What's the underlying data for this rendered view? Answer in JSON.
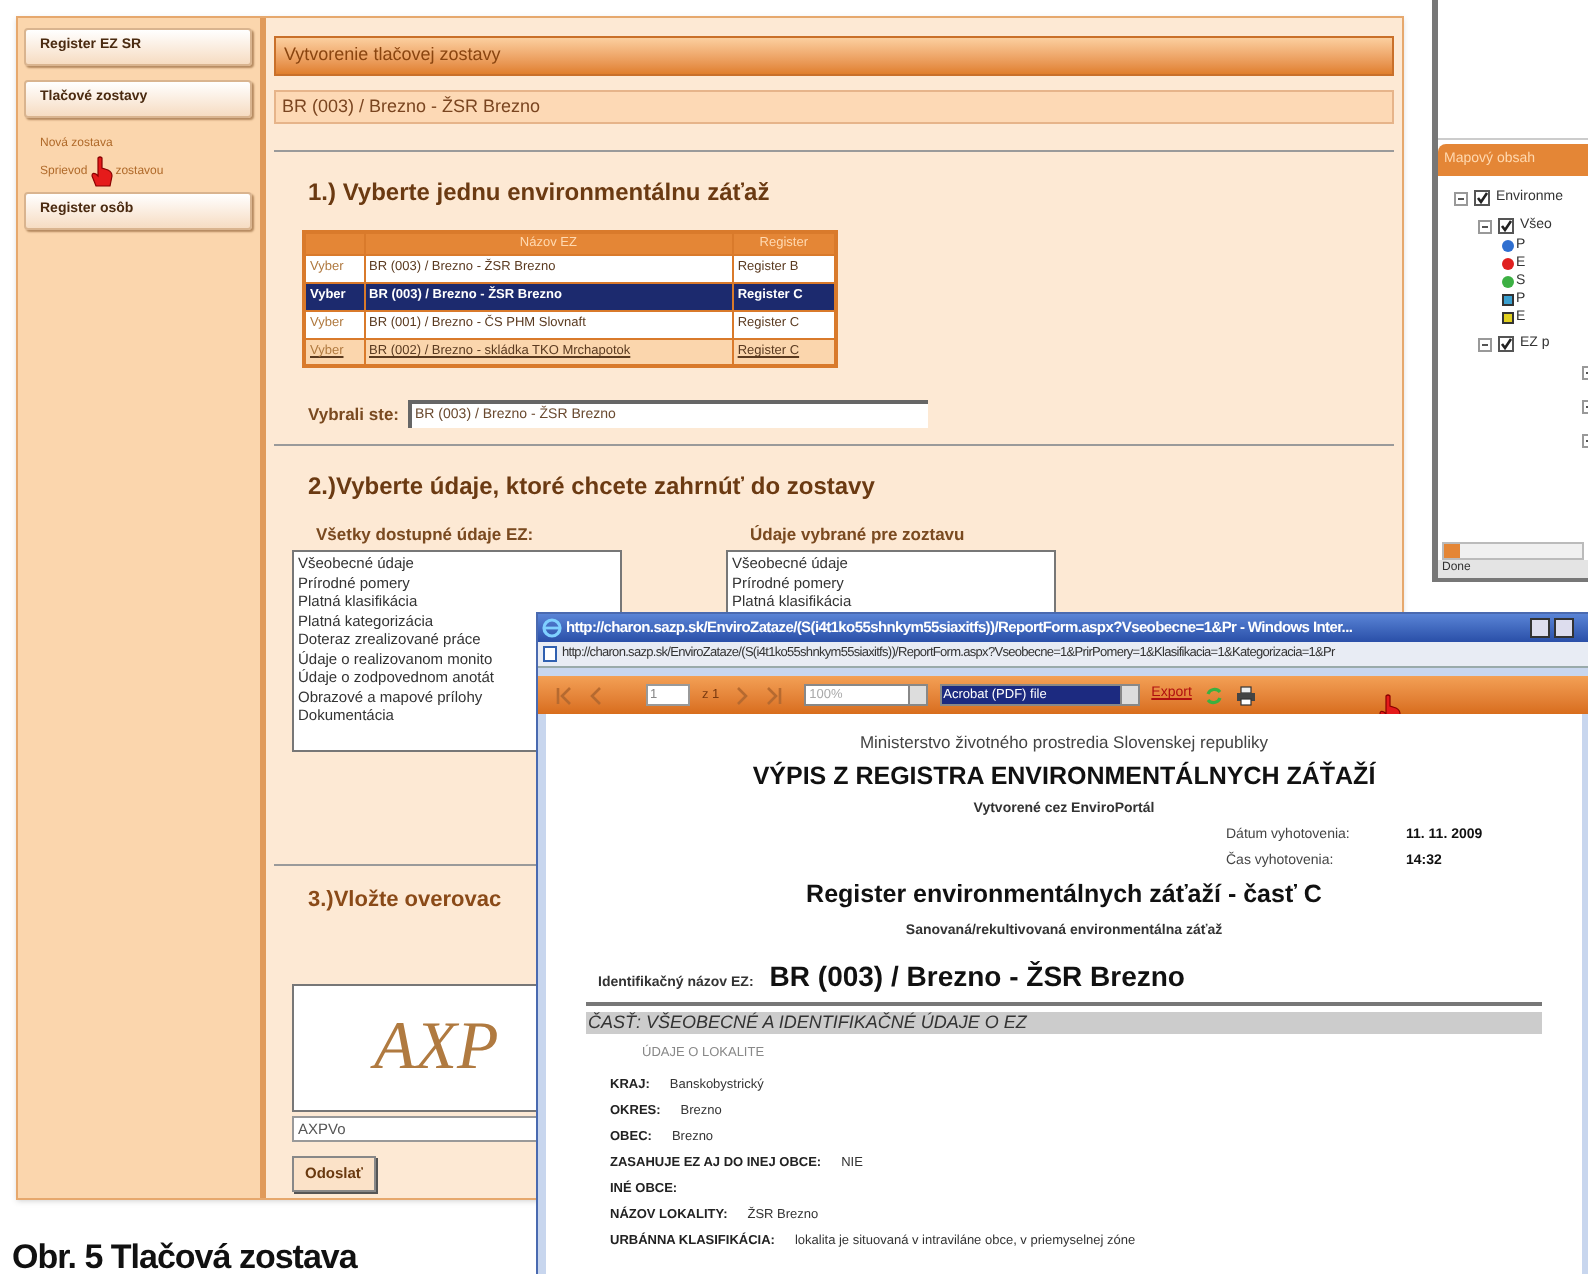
{
  "sidebar": {
    "items": [
      {
        "kind": "button",
        "label": "Register EZ SR"
      },
      {
        "kind": "button",
        "label": "Tlačové zostavy"
      },
      {
        "kind": "link",
        "label": "Nová zostava"
      },
      {
        "kind": "covered_link",
        "parts": [
          "Sprievod",
          "zostavou"
        ]
      },
      {
        "kind": "button",
        "label": "Register osôb"
      }
    ]
  },
  "page_header": "Vytvorenie tlačovej zostavy",
  "selected_bar": "BR (003) / Brezno - ŽSR Brezno",
  "step1": {
    "heading": "1.) Vyberte jednu environmentálnu záťaž",
    "table": {
      "columns": [
        "Názov EZ",
        "Register"
      ],
      "rows": [
        {
          "action": "Vyber",
          "name": "BR (003) / Brezno - ŽSR Brezno",
          "register": "Register B",
          "selected": false,
          "hovered": false
        },
        {
          "action": "Vyber",
          "name": "BR (003) / Brezno - ŽSR Brezno",
          "register": "Register C",
          "selected": true,
          "hovered": false
        },
        {
          "action": "Vyber",
          "name": "BR (001) / Brezno - ČS PHM Slovnaft",
          "register": "Register C",
          "selected": false,
          "hovered": false
        },
        {
          "action": "Vyber",
          "name": "BR (002) / Brezno - skládka TKO Mrchapotok",
          "register": "Register C",
          "selected": false,
          "hovered": true
        }
      ]
    },
    "chosen_label": "Vybrali ste:",
    "chosen_value": "BR (003) / Brezno - ŽSR Brezno"
  },
  "step2": {
    "heading": "2.)Vyberte údaje, ktoré chcete zahrnúť do zostavy",
    "available_label": "Všetky dostupné údaje EZ:",
    "available_items": [
      "Všeobecné údaje",
      "Prírodné pomery",
      "Platná klasifikácia",
      "Platná kategorizácia",
      "Doteraz zrealizované práce",
      "Údaje o realizovanom monito",
      "Údaje o zodpovednom anotát",
      "Obrazové a mapové prílohy",
      "Dokumentácia"
    ],
    "chosen_label": "Údaje vybrané pre zoztavu",
    "chosen_items": [
      "Všeobecné údaje",
      "Prírodné pomery",
      "Platná klasifikácia"
    ]
  },
  "step3": {
    "heading": "3.)Vložte overovac",
    "captcha": "AXP",
    "input_value": "AXPVo",
    "button": "Odoslať"
  },
  "map_panel": {
    "tab": "Mapový obsah",
    "tree": [
      {
        "label": "Environme",
        "checked": true,
        "expanded": true,
        "children": [
          {
            "label": "Všeo",
            "checked": true,
            "expanded": true,
            "legend": [
              {
                "kind": "dot",
                "color": "#2f6fd0",
                "label": "P"
              },
              {
                "kind": "dot",
                "color": "#e02020",
                "label": "E"
              },
              {
                "kind": "dot",
                "color": "#3cb043",
                "label": "S"
              },
              {
                "kind": "square",
                "color": "#3aa0d0",
                "label": "P"
              },
              {
                "kind": "square",
                "color": "#e0d020",
                "label": "E"
              }
            ]
          },
          {
            "label": "EZ p",
            "checked": true,
            "expanded": true,
            "children": [
              {
                "expanded": true
              },
              {
                "expanded": true
              },
              {
                "expanded": true
              }
            ]
          }
        ]
      }
    ],
    "status": "Done"
  },
  "popup": {
    "title": "http://charon.sazp.sk/EnviroZataze/(S(i4t1ko55shnkym55siaxitfs))/ReportForm.aspx?Vseobecne=1&Pr - Windows Inter...",
    "address": "http://charon.sazp.sk/EnviroZataze/(S(i4t1ko55shnkym55siaxitfs))/ReportForm.aspx?Vseobecne=1&PrirPomery=1&Klasifikacia=1&Kategorizacia=1&Pr",
    "toolbar": {
      "page": "1",
      "page_count": "z 1",
      "zoom": "100%",
      "format": "Acrobat (PDF) file",
      "export": "Export"
    },
    "report": {
      "ministry": "Ministerstvo životného prostredia Slovenskej republiky",
      "title": "VÝPIS Z REGISTRA ENVIRONMENTÁLNYCH ZÁŤAŽÍ",
      "subtitle": "Vytvorené cez EnviroPortál",
      "meta": [
        {
          "label": "Dátum vyhotovenia:",
          "value": "11. 11. 2009"
        },
        {
          "label": "Čas vyhotovenia:",
          "value": "14:32"
        }
      ],
      "register_title": "Register environmentálnych záťaží - časť C",
      "register_subtitle": "Sanovaná/rekultivovaná environmentálna záťaž",
      "id_label": "Identifikačný názov EZ:",
      "id_value": "BR (003) / Brezno - ŽSR Brezno",
      "section": "ČASŤ: VŠEOBECNÉ A IDENTIFIKAČNÉ ÚDAJE O EZ",
      "subsection": "ÚDAJE O LOKALITE",
      "fields": [
        {
          "label": "KRAJ:",
          "value": "Banskobystrický"
        },
        {
          "label": "OKRES:",
          "value": "Brezno"
        },
        {
          "label": "OBEC:",
          "value": "Brezno"
        },
        {
          "label": "ZASAHUJE EZ AJ DO INEJ OBCE:",
          "value": "NIE"
        },
        {
          "label": "INÉ OBCE:"
        },
        {
          "label": "NÁZOV LOKALITY:",
          "value": "ŽSR Brezno"
        },
        {
          "label": "URBÁNNA KLASIFIKÁCIA:",
          "value": "lokalita je situovaná v intravilánе obce, v priemyselnej zóne"
        }
      ]
    }
  },
  "caption": "Obr. 5 Tlačová zostava"
}
